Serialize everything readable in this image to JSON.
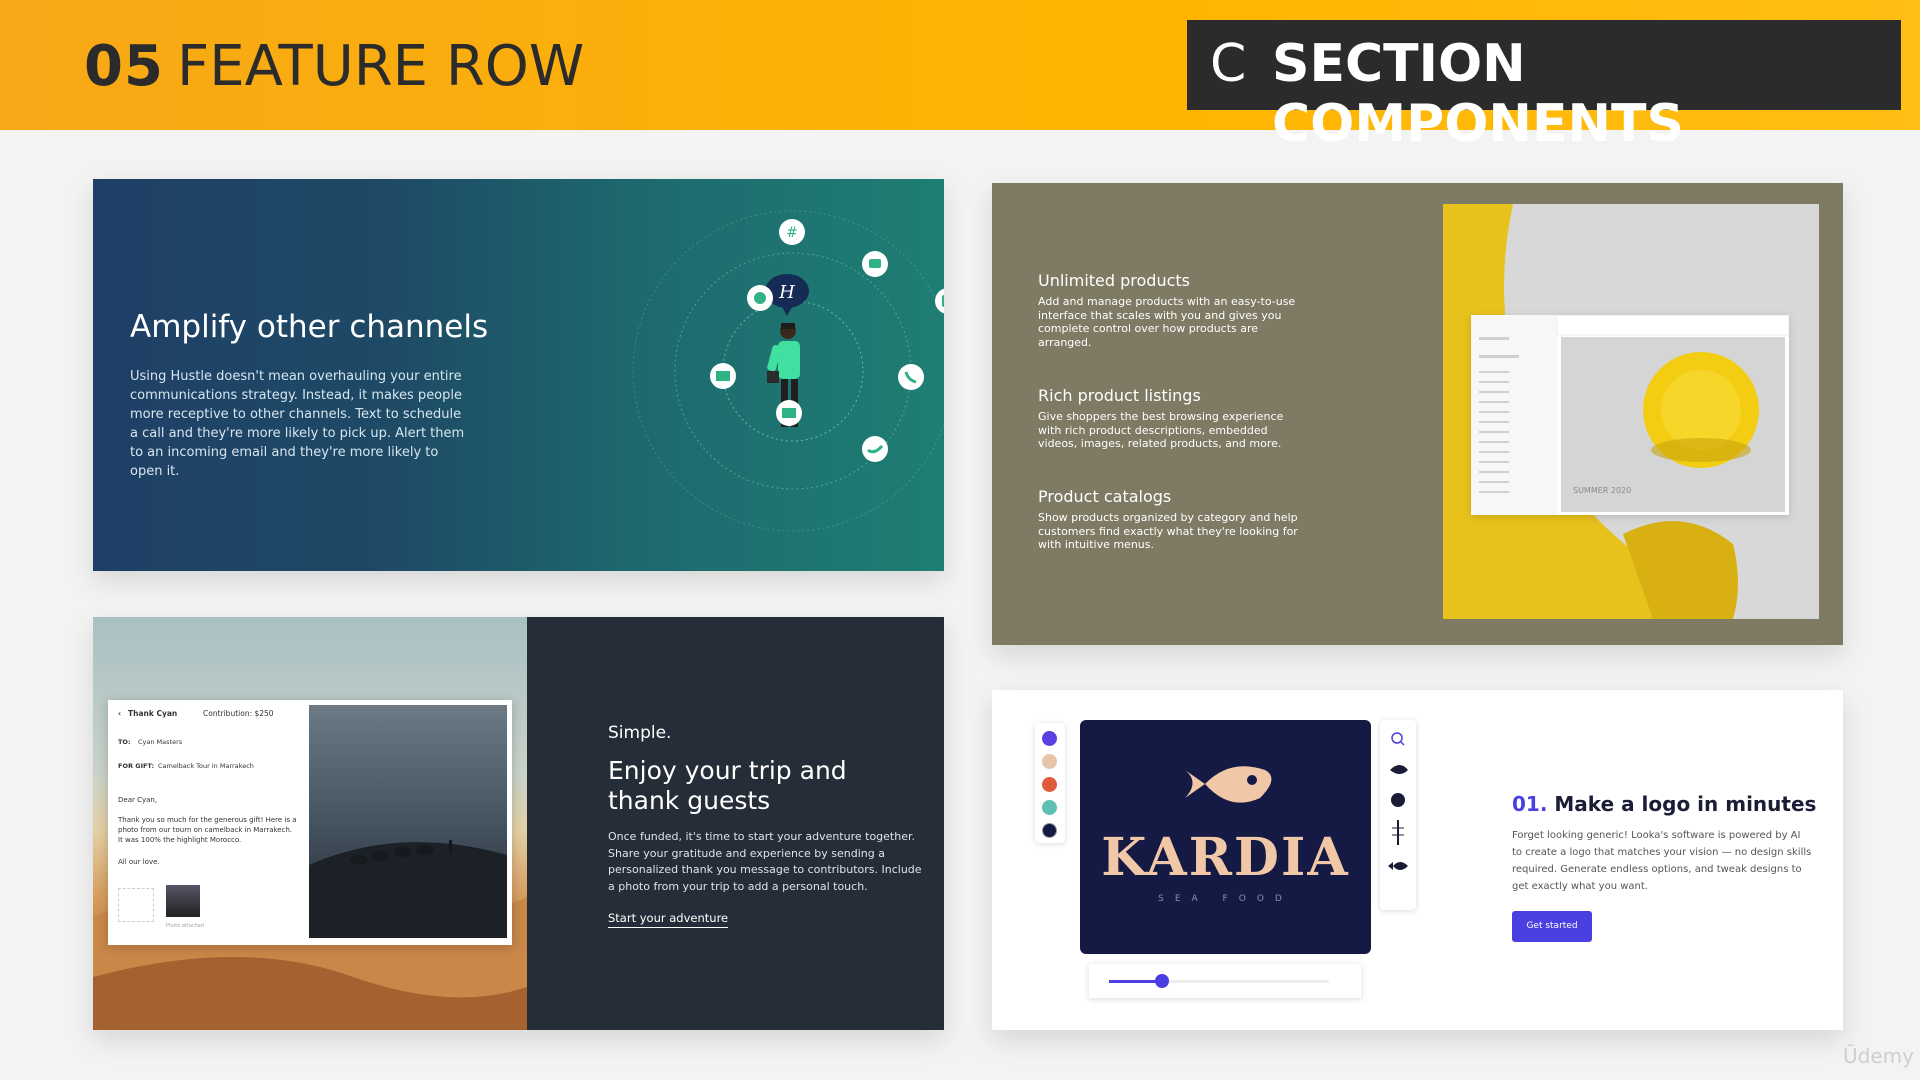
{
  "header": {
    "number": "05",
    "title": "FEATURE ROW",
    "section_letter": "C",
    "section_title": "SECTION COMPONENTS",
    "colors": {
      "bar": "#ffb400",
      "box": "#2b2b2b"
    }
  },
  "card1": {
    "title": "Amplify other channels",
    "body": "Using Hustle doesn't mean overhauling your entire communications strategy. Instead, it makes people more receptive to other channels. Text to schedule a call and they're more likely to pick up. Alert them to an incoming email and they're more likely to open it.",
    "speech_letter": "H",
    "icons": [
      "hashtag-icon",
      "chat-icon",
      "message-icon",
      "facebook-icon",
      "email-icon",
      "phone-icon",
      "mail-icon",
      "twitter-icon"
    ]
  },
  "card2": {
    "features": [
      {
        "title": "Unlimited products",
        "desc": "Add and manage products with an easy-to-use interface that scales with you and gives you complete control over how products are arranged."
      },
      {
        "title": "Rich product listings",
        "desc": "Give shoppers the best browsing experience with rich product descriptions, embedded videos, images, related products, and more."
      },
      {
        "title": "Product catalogs",
        "desc": "Show products organized by category and help customers find exactly what they're looking for with intuitive menus."
      }
    ],
    "caption": "SUMMER 2020"
  },
  "card3": {
    "letter": {
      "title": "Thank Cyan",
      "contribution": "Contribution: $250",
      "to_label": "TO:",
      "to_value": "Cyan Masters",
      "gift_label": "FOR GIFT:",
      "gift_value": "Camelback Tour in Marrakech",
      "greeting": "Dear Cyan,",
      "message": "Thank you so much for the generous gift! Here is a photo from our tourn on camelback in Marrakech. It was 100% the highlight Morocco.",
      "signoff": "All our love.",
      "attached": "Photo attached"
    },
    "kicker": "Simple.",
    "title": "Enjoy your trip and thank guests",
    "body": "Once funded, it's time to start your adventure together. Share your gratitude and experience by sending a personalized thank you message to contributors. Include a photo from your trip to add a personal touch.",
    "link": "Start your adventure"
  },
  "card4": {
    "brand": "KARDIA",
    "tagline": "SEA FOOD",
    "palette": [
      "#5b3fe0",
      "#e8c4aa",
      "#e05a3c",
      "#5ec0b0",
      "#141a43"
    ],
    "step_number": "01.",
    "title": "Make a logo in minutes",
    "body": "Forget looking generic! Looka's software is powered by AI to create a logo that matches your vision — no design skills required. Generate endless options, and tweak designs to get exactly what you want.",
    "button": "Get started",
    "slider_value": 0.24
  },
  "watermark": "Ūdemy"
}
